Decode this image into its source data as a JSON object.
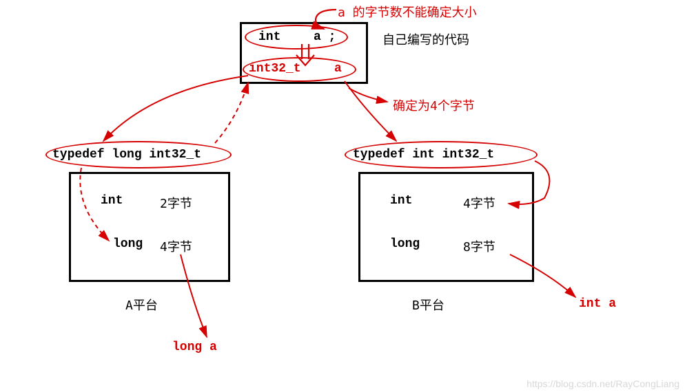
{
  "top_note": "a 的字节数不能确定大小",
  "code_box": {
    "line1_type": "int",
    "line1_var": "a ;",
    "line2_type": "int32_t",
    "line2_var": "a",
    "caption": "自己编写的代码"
  },
  "mid_note": "确定为4个字节",
  "platform_a": {
    "typedef": "typedef  long  int32_t",
    "row1_type": "int",
    "row1_size": "2字节",
    "row2_type": "long",
    "row2_size": "4字节",
    "label": "A平台",
    "result": "long   a"
  },
  "platform_b": {
    "typedef": "typedef   int  int32_t",
    "row1_type": "int",
    "row1_size": "4字节",
    "row2_type": "long",
    "row2_size": "8字节",
    "label": "B平台",
    "result": "int   a"
  },
  "watermark": "https://blog.csdn.net/RayCongLiang"
}
